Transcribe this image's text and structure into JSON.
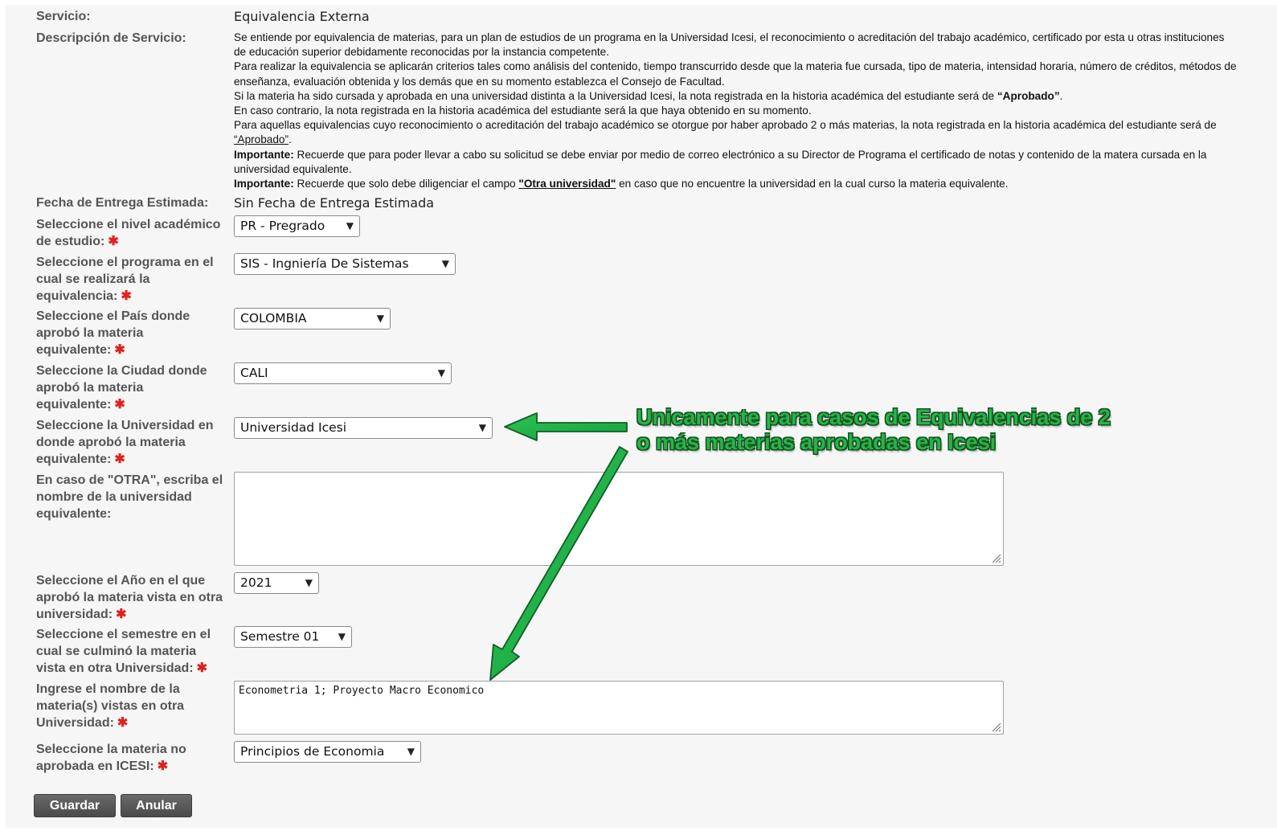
{
  "form": {
    "servicio_label": "Servicio:",
    "servicio_value": "Equivalencia Externa",
    "descripcion_label": "Descripción de Servicio:",
    "descripcion": {
      "p1": "Se entiende por equivalencia de materias, para un plan de estudios de un programa en la Universidad Icesi, el reconocimiento o acreditación del trabajo académico, certificado por esta u otras instituciones de educación superior debidamente reconocidas por la instancia competente.",
      "p2": "Para realizar la equivalencia se aplicarán criterios tales como análisis del contenido, tiempo transcurrido desde que la materia fue cursada, tipo de materia, intensidad horaria, número de créditos, métodos de enseñanza, evaluación obtenida y los demás que en su momento establezca el Consejo de Facultad.",
      "p3_a": "Si la materia ha sido cursada y aprobada en una universidad distinta a la Universidad Icesi, la nota registrada en la historia académica del estudiante será de ",
      "p3_b": "“Aprobado”",
      "p3_c": ".",
      "p4": "En caso contrario, la nota registrada en la historia académica del estudiante será la que haya obtenido en su momento.",
      "p5_a": "Para aquellas equivalencias cuyo reconocimiento o acreditación del trabajo académico se otorgue por haber aprobado 2 o más materias, la nota registrada en la historia académica del estudiante será de ",
      "p5_b": "“Aprobado”",
      "p5_c": ".",
      "p6_a": "Importante:",
      "p6_b": " Recuerde que para poder llevar a cabo su solicitud se debe enviar por medio de correo electrónico a su Director de Programa el certificado de notas y contenido de la matera cursada en la universidad equivalente.",
      "p7_a": "Importante:",
      "p7_b": " Recuerde que solo debe diligenciar el campo ",
      "p7_c": "\"Otra universidad\"",
      "p7_d": " en caso que no encuentre la universidad en la cual curso la materia equivalente."
    },
    "fecha_label": "Fecha de Entrega Estimada:",
    "fecha_value": "Sin Fecha de Entrega Estimada",
    "nivel_label": "Seleccione el nivel académico de estudio:",
    "nivel_value": "PR - Pregrado",
    "programa_label": "Seleccione el programa en el cual se realizará la equivalencia:",
    "programa_value": "SIS - Ingniería De Sistemas",
    "pais_label": "Seleccione el País donde aprobó la materia equivalente:",
    "pais_value": "COLOMBIA",
    "ciudad_label": "Seleccione la Ciudad donde aprobó la materia equivalente:",
    "ciudad_value": "CALI",
    "universidad_label": "Seleccione la Universidad en donde aprobó la materia equivalente:",
    "universidad_value": "Universidad Icesi",
    "otra_label": "En caso de \"OTRA\", escriba el nombre de la universidad equivalente:",
    "otra_value": "",
    "anio_label": "Seleccione el Año en el que aprobó la materia vista en otra universidad:",
    "anio_value": "2021",
    "semestre_label": "Seleccione el semestre en el cual se culminó la materia vista en otra Universidad:",
    "semestre_value": "Semestre 01",
    "materias_label": "Ingrese el nombre de la materia(s) vistas en otra Universidad:",
    "materias_value": "Econometria 1; Proyecto Macro Economico",
    "no_aprobada_label": "Seleccione la materia no aprobada en ICESI:",
    "no_aprobada_value": "Principios de Economia",
    "required_mark": "✱"
  },
  "buttons": {
    "guardar": "Guardar",
    "anular": "Anular"
  },
  "annotation": {
    "line1": "Unicamente para casos de Equivalencias de 2",
    "line2": "o más materias aprobadas en Icesi",
    "color": "#29b34a"
  },
  "icons": {
    "dropdown": "chevron-down-icon",
    "resize": "resize-grip-icon",
    "required": "asterisk-icon"
  }
}
